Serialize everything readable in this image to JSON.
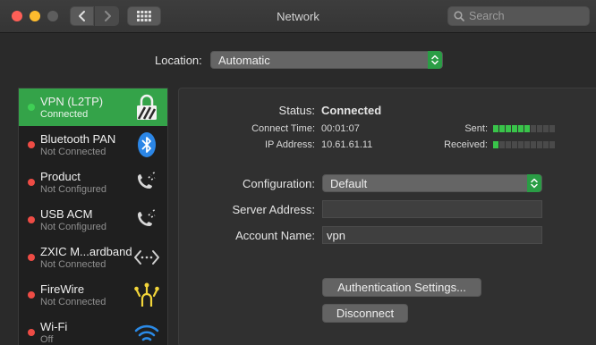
{
  "window": {
    "title": "Network",
    "search_placeholder": "Search"
  },
  "location": {
    "label": "Location:",
    "value": "Automatic"
  },
  "services": [
    {
      "name": "VPN (L2TP)",
      "status": "Connected",
      "status_color": "#3fcf55",
      "icon": "lock-icon",
      "selected": true
    },
    {
      "name": "Bluetooth PAN",
      "status": "Not Connected",
      "status_color": "#ee4c45",
      "icon": "bluetooth-icon"
    },
    {
      "name": "Product",
      "status": "Not Configured",
      "status_color": "#ee4c45",
      "icon": "phone-icon"
    },
    {
      "name": "USB ACM",
      "status": "Not Configured",
      "status_color": "#ee4c45",
      "icon": "phone-icon"
    },
    {
      "name": "ZXIC M...ardband",
      "status": "Not Connected",
      "status_color": "#ee4c45",
      "icon": "network-arrows-icon"
    },
    {
      "name": "FireWire",
      "status": "Not Connected",
      "status_color": "#ee4c45",
      "icon": "firewire-icon"
    },
    {
      "name": "Wi-Fi",
      "status": "Off",
      "status_color": "#ee4c45",
      "icon": "wifi-icon"
    }
  ],
  "detail": {
    "status_label": "Status:",
    "status_value": "Connected",
    "connect_time_label": "Connect Time:",
    "connect_time_value": "00:01:07",
    "ip_label": "IP Address:",
    "ip_value": "10.61.61.11",
    "sent_label": "Sent:",
    "sent_level": 0.55,
    "received_label": "Received:",
    "received_level": 0.1,
    "configuration_label": "Configuration:",
    "configuration_value": "Default",
    "server_label": "Server Address:",
    "server_value": "",
    "account_label": "Account Name:",
    "account_value": "vpn",
    "auth_button": "Authentication Settings...",
    "disconnect_button": "Disconnect"
  },
  "colors": {
    "selected_row": "#34a349",
    "popup_accent": "#2a9d45",
    "meter_on": "#39c44a"
  }
}
